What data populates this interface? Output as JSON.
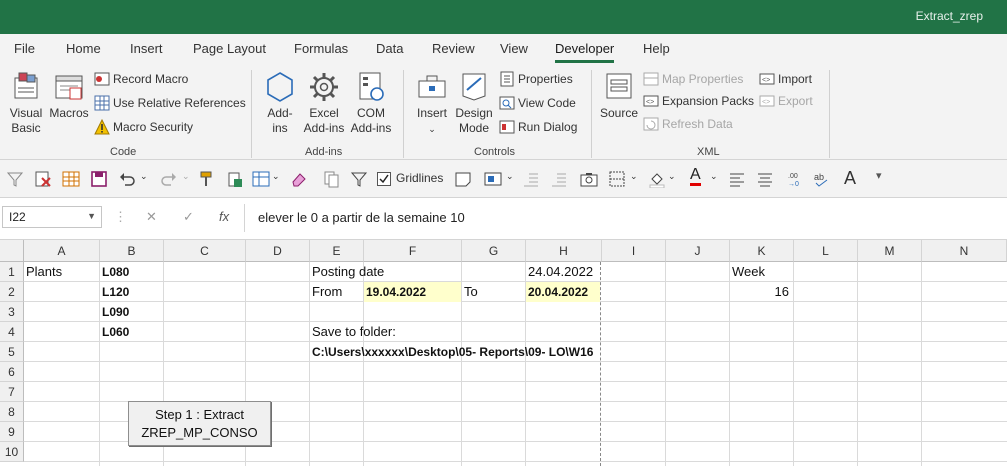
{
  "window": {
    "title": "Extract_zrep"
  },
  "tabs": [
    "File",
    "Home",
    "Insert",
    "Page Layout",
    "Formulas",
    "Data",
    "Review",
    "View",
    "Developer",
    "Help"
  ],
  "active_tab": "Developer",
  "ribbon": {
    "code": {
      "label": "Code",
      "visual_basic": [
        "Visual",
        "Basic"
      ],
      "macros": "Macros",
      "record_macro": "Record Macro",
      "relative_refs": "Use Relative References",
      "macro_security": "Macro Security"
    },
    "addins": {
      "label": "Add-ins",
      "addins": [
        "Add-",
        "ins"
      ],
      "excel_addins": [
        "Excel",
        "Add-ins"
      ],
      "com_addins": [
        "COM",
        "Add-ins"
      ]
    },
    "controls": {
      "label": "Controls",
      "insert": "Insert",
      "design_mode": [
        "Design",
        "Mode"
      ],
      "properties": "Properties",
      "view_code": "View Code",
      "run_dialog": "Run Dialog"
    },
    "xml": {
      "label": "XML",
      "source": "Source",
      "map_properties": "Map Properties",
      "expansion_packs": "Expansion Packs",
      "refresh_data": "Refresh Data",
      "import": "Import",
      "export": "Export"
    }
  },
  "quick_toolbar": {
    "gridlines_label": "Gridlines",
    "gridlines_checked": true
  },
  "formula_bar": {
    "name_box": "I22",
    "cancel_icon": "✕",
    "enter_icon": "✓",
    "fx_icon": "fx",
    "content": "elever le 0 a partir de la semaine 10"
  },
  "sheet": {
    "columns": [
      "A",
      "B",
      "C",
      "D",
      "E",
      "F",
      "G",
      "H",
      "I",
      "J",
      "K",
      "L",
      "M",
      "N"
    ],
    "rows": [
      "1",
      "2",
      "3",
      "4",
      "5",
      "6",
      "7",
      "8",
      "9",
      "10"
    ],
    "cells": {
      "A1": "Plants",
      "B1": "L080",
      "B2": "L120",
      "B3": "L090",
      "B4": "L060",
      "E1": "Posting date",
      "H1": "24.04.2022",
      "E2": "From",
      "F2": "19.04.2022",
      "G2": "To",
      "H2": "20.04.2022",
      "K1": "Week",
      "K2": "16",
      "E4": "Save to folder:",
      "E5": "C:\\Users\\xxxxxx\\Desktop\\05- Reports\\09- LO\\W16"
    },
    "macro_button": [
      "Step 1 : Extract",
      "ZREP_MP_CONSO"
    ]
  }
}
